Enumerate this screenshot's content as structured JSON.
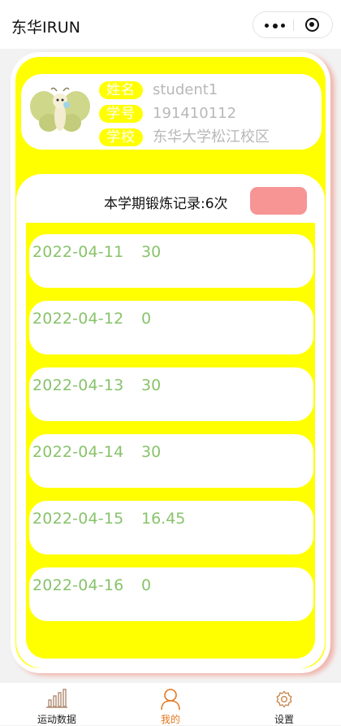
{
  "app": {
    "title": "东华IRUN"
  },
  "profile": {
    "name_label": "姓名",
    "name_value": "student1",
    "id_label": "学号",
    "id_value": "191410112",
    "school_label": "学校",
    "school_value": "东华大学松江校区"
  },
  "records": {
    "title": "本学期锻炼记录:6次",
    "items": [
      {
        "date": "2022-04-11",
        "value": "30"
      },
      {
        "date": "2022-04-12",
        "value": "0"
      },
      {
        "date": "2022-04-13",
        "value": "30"
      },
      {
        "date": "2022-04-14",
        "value": "30"
      },
      {
        "date": "2022-04-15",
        "value": "16.45"
      },
      {
        "date": "2022-04-16",
        "value": "0"
      }
    ]
  },
  "tabbar": {
    "tabs": [
      {
        "label": "运动数据",
        "icon": "bar-chart-icon",
        "active": false
      },
      {
        "label": "我的",
        "icon": "user-icon",
        "active": true
      },
      {
        "label": "设置",
        "icon": "gear-icon",
        "active": false
      }
    ]
  },
  "colors": {
    "accent_yellow": "#ffff00",
    "record_text_green": "#88c36b",
    "button_pink": "#f79494",
    "active_tab_orange": "#e4771f"
  }
}
